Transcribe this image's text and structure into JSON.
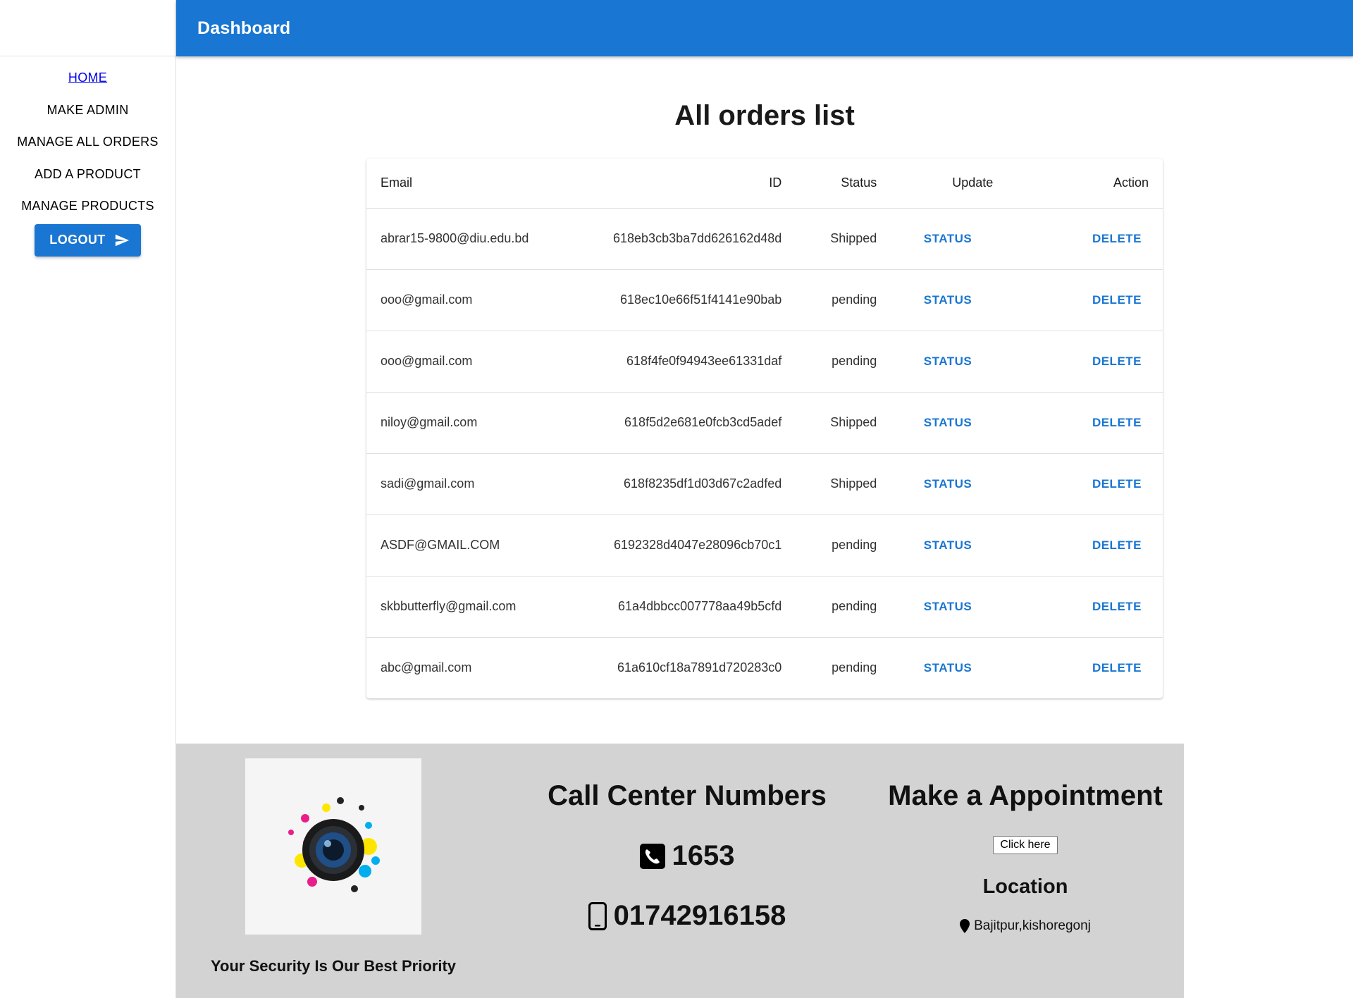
{
  "appbar": {
    "title": "Dashboard"
  },
  "sidebar": {
    "items": [
      {
        "label": "HOME"
      },
      {
        "label": "MAKE ADMIN"
      },
      {
        "label": "MANAGE ALL ORDERS"
      },
      {
        "label": "ADD A PRODUCT"
      },
      {
        "label": "MANAGE PRODUCTS"
      }
    ],
    "logout_label": "LOGOUT",
    "logout_icon": "send-icon"
  },
  "main": {
    "title": "All orders list",
    "columns": [
      "Email",
      "ID",
      "Status",
      "Update",
      "Action"
    ],
    "rows": [
      {
        "email": "abrar15-9800@diu.edu.bd",
        "id": "618eb3cb3ba7dd626162d48d",
        "status": "Shipped",
        "update": "STATUS",
        "action": "DELETE"
      },
      {
        "email": "ooo@gmail.com",
        "id": "618ec10e66f51f4141e90bab",
        "status": "pending",
        "update": "STATUS",
        "action": "DELETE"
      },
      {
        "email": "ooo@gmail.com",
        "id": "618f4fe0f94943ee61331daf",
        "status": "pending",
        "update": "STATUS",
        "action": "DELETE"
      },
      {
        "email": "niloy@gmail.com",
        "id": "618f5d2e681e0fcb3cd5adef",
        "status": "Shipped",
        "update": "STATUS",
        "action": "DELETE"
      },
      {
        "email": "sadi@gmail.com",
        "id": "618f8235df1d03d67c2adfed",
        "status": "Shipped",
        "update": "STATUS",
        "action": "DELETE"
      },
      {
        "email": "ASDF@GMAIL.COM",
        "id": "6192328d4047e28096cb70c1",
        "status": "pending",
        "update": "STATUS",
        "action": "DELETE"
      },
      {
        "email": "skbbutterfly@gmail.com",
        "id": "61a4dbbcc007778aa49b5cfd",
        "status": "pending",
        "update": "STATUS",
        "action": "DELETE"
      },
      {
        "email": "abc@gmail.com",
        "id": "61a610cf18a7891d720283c0",
        "status": "pending",
        "update": "STATUS",
        "action": "DELETE"
      }
    ]
  },
  "footer": {
    "tagline": "Your Security Is Our Best Priority",
    "call_center_title": "Call Center Numbers",
    "phone_landline": "1653",
    "phone_mobile": "01742916158",
    "appointment_title": "Make a Appointment",
    "appointment_button": "Click here",
    "location_title": "Location",
    "location_text": "Bajitpur,kishoregonj"
  },
  "colors": {
    "primary": "#1976d2",
    "footer_bg": "#d3d3d3"
  }
}
